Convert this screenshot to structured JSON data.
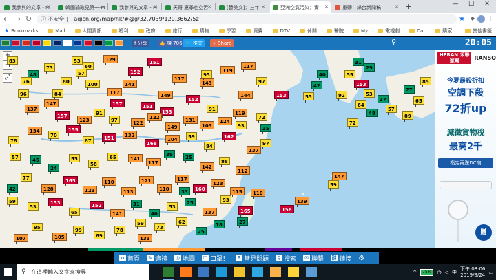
{
  "tabs": [
    {
      "title": "我參與的文章 - M",
      "favicon_color": "#1e8e3e"
    },
    {
      "title": "韓國瑜政見第一-M",
      "favicon_color": "#1e8e3e"
    },
    {
      "title": "我參與的文章 - M",
      "favicon_color": "#1e8e3e"
    },
    {
      "title": "天哥 夏季也空污",
      "favicon_color": "#1e8e3e"
    },
    {
      "title": "[替美文]：三年",
      "favicon_color": "#1e8e3e"
    },
    {
      "title": "亞洲空氣污染：實",
      "favicon_color": "#3f8f3f"
    },
    {
      "title": "重磅！綠台新聞稿",
      "favicon_color": "#e0533c"
    }
  ],
  "window_controls": {
    "minimize": "—",
    "maximize": "☐",
    "close": "✕"
  },
  "address_bar": {
    "security_label": "不安全",
    "url": "aqicn.org/map/hk/#@g/32.7039/120.3662/5z"
  },
  "bookmarks": {
    "items": [
      {
        "label": "Bookmarks",
        "type": "star"
      },
      {
        "label": "Mail",
        "type": "folder"
      },
      {
        "label": "人間資訊",
        "type": "folder"
      },
      {
        "label": "福利",
        "type": "folder"
      },
      {
        "label": "政府",
        "type": "folder"
      },
      {
        "label": "旅行",
        "type": "folder"
      },
      {
        "label": "購物",
        "type": "folder"
      },
      {
        "label": "學習",
        "type": "folder"
      },
      {
        "label": "資費",
        "type": "folder"
      },
      {
        "label": "DTV",
        "type": "folder"
      },
      {
        "label": "休閒",
        "type": "folder"
      },
      {
        "label": "醫院",
        "type": "folder"
      },
      {
        "label": "My",
        "type": "folder"
      },
      {
        "label": "電視劇",
        "type": "folder"
      },
      {
        "label": "Car",
        "type": "folder"
      },
      {
        "label": "購家",
        "type": "folder"
      }
    ],
    "other": "其他書籤"
  },
  "site_header": {
    "flags": [
      "#1e7d3a",
      "#c8102e",
      "#d52b1e",
      "#bc002d",
      "#ffd700",
      "#012169",
      "#ffffff",
      "#003893",
      "#ce1126",
      "#000000",
      "#009c3b",
      "#ff9933"
    ],
    "share_fb_label": "分享",
    "like_label": "讚 706",
    "share_tw_label": "推文",
    "share_label": "Share",
    "clock": "20:05"
  },
  "map": {
    "controls": {
      "zoom_in": "+",
      "zoom_out": "−",
      "fullscreen": "⤢"
    },
    "colors": {
      "good": "#009966",
      "moderate": "#ffde33",
      "usg": "#ff9933",
      "unhealthy": "#cc0033",
      "very_unhealthy": "#660099"
    },
    "station_values": [
      "48",
      "73",
      "53",
      "60",
      "57",
      "80",
      "100",
      "117",
      "84",
      "157",
      "153",
      "152",
      "151",
      "91",
      "149",
      "143",
      "117",
      "95",
      "119",
      "117",
      "96",
      "137",
      "147",
      "157",
      "123",
      "91",
      "97",
      "122",
      "122",
      "149",
      "131",
      "103",
      "124",
      "119",
      "72",
      "35",
      "134",
      "70",
      "155",
      "87",
      "151",
      "132",
      "168",
      "104",
      "59",
      "84",
      "162",
      "93",
      "137",
      "97",
      "57",
      "45",
      "24",
      "55",
      "58",
      "65",
      "141",
      "117",
      "38",
      "25",
      "142",
      "88",
      "112",
      "77",
      "128",
      "165",
      "123",
      "110",
      "113",
      "121",
      "110",
      "117",
      "160",
      "123",
      "115",
      "59",
      "53",
      "153",
      "65",
      "152",
      "141",
      "31",
      "40",
      "53",
      "25",
      "137",
      "93",
      "165",
      "110",
      "27",
      "18",
      "25",
      "62",
      "73",
      "59",
      "78",
      "69",
      "99",
      "105",
      "95",
      "107",
      "158",
      "139",
      "147",
      "59",
      "55",
      "153",
      "53",
      "40",
      "42",
      "55",
      "29",
      "31",
      "27",
      "65",
      "85",
      "89",
      "57",
      "37",
      "48",
      "64",
      "72",
      "92",
      "83",
      "76",
      "78",
      "42",
      "129",
      "152",
      "151",
      "141",
      "144",
      "97",
      "153",
      "33",
      "133"
    ]
  },
  "ad": {
    "brand_a": "HERAN 禾聯家電",
    "brand_b": "RANSO",
    "line1": "今夏最殺折扣",
    "line2": "空調下殺",
    "line3": "72折up",
    "line4": "減徵貨物稅",
    "line5": "最高2千",
    "coupon": "指定再送DC扇",
    "gift": "贈"
  },
  "site_nav": {
    "items": [
      {
        "label": "首頁",
        "icon": "⌂"
      },
      {
        "label": "追禮",
        "icon": "✎"
      },
      {
        "label": "地圖",
        "icon": "◎"
      },
      {
        "label": "口罩！",
        "icon": "☐"
      },
      {
        "label": "常見問題",
        "icon": "?"
      },
      {
        "label": "搜索",
        "icon": "⚲"
      },
      {
        "label": "聯繫",
        "icon": "✉"
      },
      {
        "label": "鏈接",
        "icon": "⛓"
      }
    ],
    "settings_icon": "⚙"
  },
  "taskbar": {
    "search_placeholder": "在這裡輸入文字來搜尋",
    "apps": [
      "#2d7d32",
      "#ff7a1a",
      "#3a78c4",
      "#1e9bd7",
      "#f2c12e",
      "#2fa7e0",
      "#f6b24b",
      "#ffd43a",
      "#5a9bd4"
    ],
    "battery": "75%",
    "time": "下午 08:06",
    "date": "2019/8/24"
  }
}
